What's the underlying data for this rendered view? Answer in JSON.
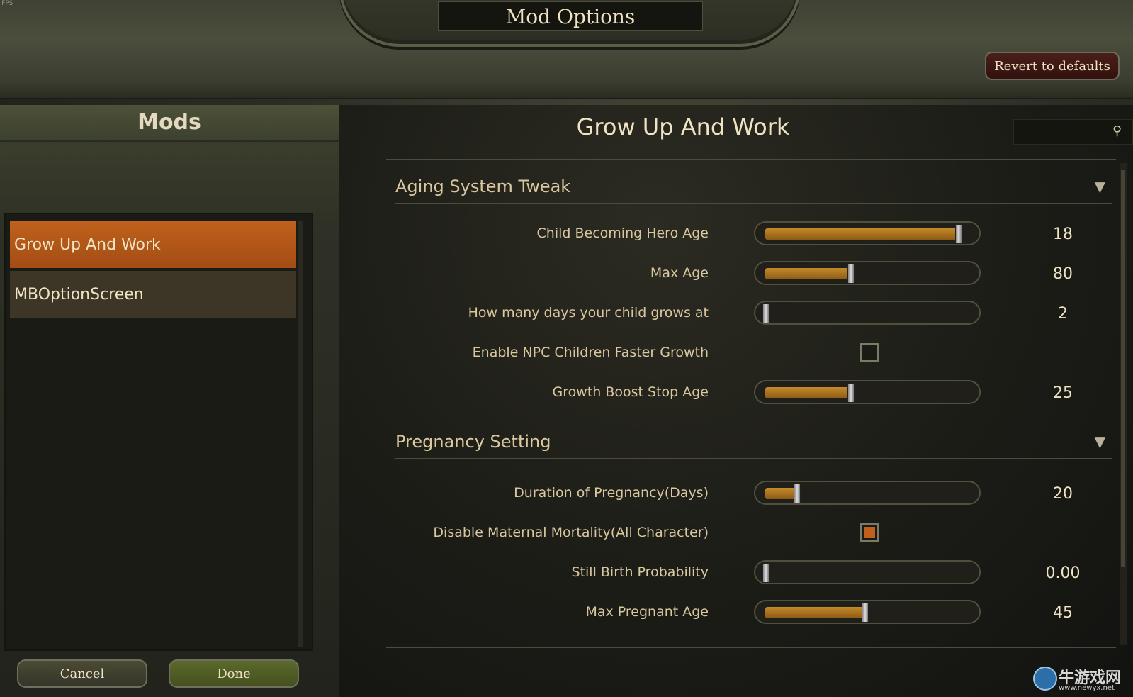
{
  "fps_label": "FPS",
  "window": {
    "title": "Mod Options"
  },
  "top": {
    "revert_label": "Revert to defaults"
  },
  "left": {
    "header": "Mods",
    "items": [
      {
        "label": "Grow Up And Work",
        "selected": true
      },
      {
        "label": "MBOptionScreen",
        "selected": false
      }
    ],
    "cancel_label": "Cancel",
    "done_label": "Done"
  },
  "right": {
    "title": "Grow Up And Work",
    "search_placeholder": "",
    "sections": [
      {
        "title": "Aging System Tweak",
        "options": [
          {
            "label": "Child Becoming Hero Age",
            "type": "slider",
            "value": "18",
            "fill": 0.93
          },
          {
            "label": "Max Age",
            "type": "slider",
            "value": "80",
            "fill": 0.41
          },
          {
            "label": "How many days your child grows at",
            "type": "slider",
            "value": "2",
            "fill": 0.0
          },
          {
            "label": "Enable NPC Children Faster Growth",
            "type": "checkbox",
            "checked": false
          },
          {
            "label": "Growth Boost Stop Age",
            "type": "slider",
            "value": "25",
            "fill": 0.41
          }
        ]
      },
      {
        "title": "Pregnancy Setting",
        "options": [
          {
            "label": "Duration of Pregnancy(Days)",
            "type": "slider",
            "value": "20",
            "fill": 0.15
          },
          {
            "label": "Disable Maternal Mortality(All Character)",
            "type": "checkbox",
            "checked": true
          },
          {
            "label": "Still Birth Probability",
            "type": "slider",
            "value": "0.00",
            "fill": 0.0
          },
          {
            "label": "Max Pregnant Age",
            "type": "slider",
            "value": "45",
            "fill": 0.48
          }
        ]
      }
    ]
  },
  "watermark": {
    "text": "牛游戏网",
    "url": "www.newyx.net"
  },
  "colors": {
    "accent": "#c0601c",
    "text": "#efe3c4",
    "slider_fill": "#c48a2a"
  }
}
